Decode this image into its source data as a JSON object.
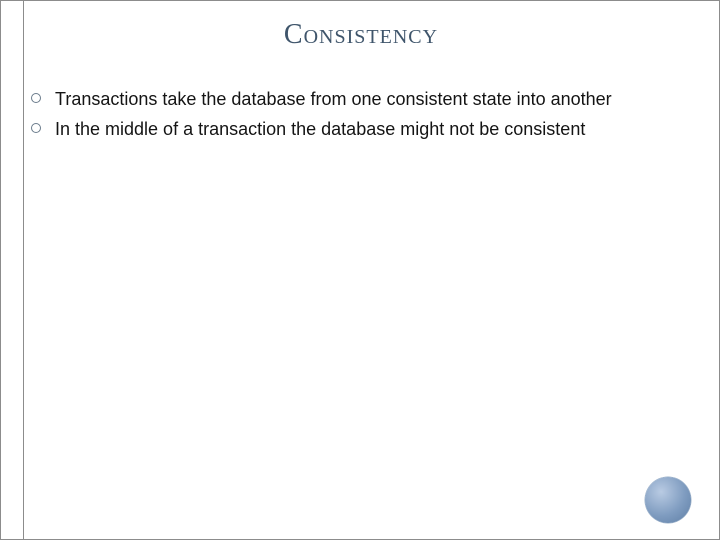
{
  "title": "Consistency",
  "bullets": [
    {
      "text": "Transactions take the database from one consistent state into another"
    },
    {
      "text": "In the middle of a transaction the database might not be consistent"
    }
  ]
}
